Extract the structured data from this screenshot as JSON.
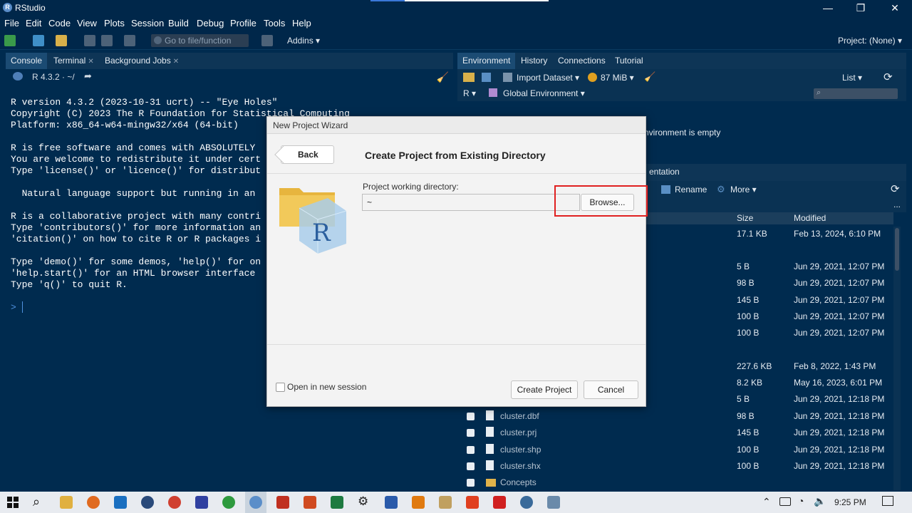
{
  "window": {
    "title": "RStudio",
    "controls": [
      "—",
      "❐",
      "✕"
    ]
  },
  "menu": [
    "File",
    "Edit",
    "Code",
    "View",
    "Plots",
    "Session",
    "Build",
    "Debug",
    "Profile",
    "Tools",
    "Help"
  ],
  "toolbar": {
    "goto_placeholder": "Go to file/function",
    "addins_label": "Addins ▾",
    "project_label": "Project: (None) ▾"
  },
  "left_pane": {
    "tabs": [
      {
        "label": "Console",
        "active": true
      },
      {
        "label": "Terminal",
        "closable": true
      },
      {
        "label": "Background Jobs",
        "closable": true
      }
    ],
    "r_version": "R 4.3.2 · ~/",
    "console_lines": [
      "R version 4.3.2 (2023-10-31 ucrt) -- \"Eye Holes\"",
      "Copyright (C) 2023 The R Foundation for Statistical Computing",
      "Platform: x86_64-w64-mingw32/x64 (64-bit)",
      "",
      "R is free software and comes with ABSOLUTELY",
      "You are welcome to redistribute it under cert",
      "Type 'license()' or 'licence()' for distribut",
      "",
      "  Natural language support but running in an",
      "",
      "R is a collaborative project with many contri",
      "Type 'contributors()' for more information an",
      "'citation()' on how to cite R or R packages i",
      "",
      "Type 'demo()' for some demos, 'help()' for on",
      "'help.start()' for an HTML browser interface",
      "Type 'q()' to quit R."
    ],
    "prompt": ">"
  },
  "right_pane": {
    "tabs": [
      "Environment",
      "History",
      "Connections",
      "Tutorial"
    ],
    "import_dataset": "Import Dataset ▾",
    "memory": "87 MiB ▾",
    "list_label": "List ▾",
    "r_label": "R ▾",
    "global_env": "Global Environment ▾",
    "env_empty": "nvironment is empty",
    "files_tab_partial": "entation",
    "rename_label": "Rename",
    "more_label": "More ▾",
    "ellipsis": "...",
    "columns": {
      "size": "Size",
      "modified": "Modified"
    },
    "rows": [
      {
        "name": "",
        "size": "17.1 KB",
        "modified": "Feb 13, 2024, 6:10 PM"
      },
      {
        "name": "",
        "size": "5 B",
        "modified": "Jun 29, 2021, 12:07 PM"
      },
      {
        "name": "",
        "size": "98 B",
        "modified": "Jun 29, 2021, 12:07 PM"
      },
      {
        "name": "",
        "size": "145 B",
        "modified": "Jun 29, 2021, 12:07 PM"
      },
      {
        "name": "",
        "size": "100 B",
        "modified": "Jun 29, 2021, 12:07 PM"
      },
      {
        "name": "",
        "size": "100 B",
        "modified": "Jun 29, 2021, 12:07 PM"
      },
      {
        "name": "",
        "size": "227.6 KB",
        "modified": "Feb 8, 2022, 1:43 PM"
      },
      {
        "name": "",
        "size": "8.2 KB",
        "modified": "May 16, 2023, 6:01 PM"
      },
      {
        "name": "",
        "size": "5 B",
        "modified": "Jun 29, 2021, 12:18 PM"
      },
      {
        "name": "cluster.dbf",
        "size": "98 B",
        "modified": "Jun 29, 2021, 12:18 PM"
      },
      {
        "name": "cluster.prj",
        "size": "145 B",
        "modified": "Jun 29, 2021, 12:18 PM"
      },
      {
        "name": "cluster.shp",
        "size": "100 B",
        "modified": "Jun 29, 2021, 12:18 PM"
      },
      {
        "name": "cluster.shx",
        "size": "100 B",
        "modified": "Jun 29, 2021, 12:18 PM"
      },
      {
        "name": "Concepts",
        "size": "",
        "modified": "",
        "folder": true
      }
    ]
  },
  "dialog": {
    "title": "New Project Wizard",
    "back_label": "Back",
    "heading": "Create Project from Existing Directory",
    "dir_label": "Project working directory:",
    "dir_value": "~",
    "browse_label": "Browse...",
    "new_session_label": "Open in new session",
    "new_session_checked": false,
    "create_label": "Create Project",
    "cancel_label": "Cancel",
    "highlight_color": "#e02020"
  },
  "taskbar": {
    "time": "9:25 PM"
  }
}
